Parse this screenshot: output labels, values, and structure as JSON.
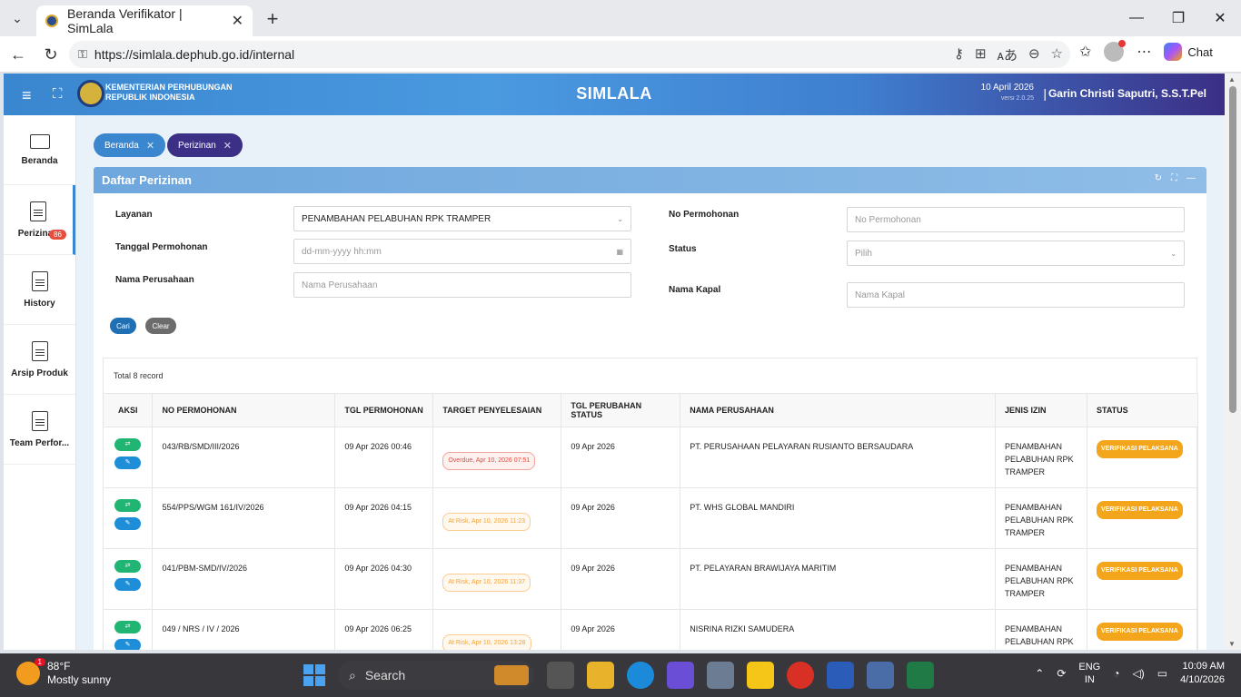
{
  "browser": {
    "tab_title": "Beranda Verifikator | SimLala",
    "url": "https://simlala.dephub.go.id/internal",
    "chat_label": "Chat"
  },
  "header": {
    "ministry_line1": "KEMENTERIAN PERHUBUNGAN",
    "ministry_line2": "REPUBLIK INDONESIA",
    "app_title": "SIMLALA",
    "date": "10 April 2026",
    "version": "versi 2.0.25",
    "separator": "|",
    "user": "Garin Christi Saputri, S.S.T.Pel"
  },
  "sidebar": {
    "items": [
      {
        "label": "Beranda"
      },
      {
        "label": "Perizinan",
        "badge": "86"
      },
      {
        "label": "History"
      },
      {
        "label": "Arsip Produk"
      },
      {
        "label": "Team Perfor..."
      }
    ]
  },
  "breadcrumb": {
    "items": [
      {
        "label": "Beranda"
      },
      {
        "label": "Perizinan"
      }
    ]
  },
  "panel": {
    "title": "Daftar Perizinan"
  },
  "filters": {
    "layanan_label": "Layanan",
    "layanan_value": "PENAMBAHAN PELABUHAN RPK TRAMPER",
    "tanggal_label": "Tanggal Permohonan",
    "tanggal_placeholder": "dd-mm-yyyy hh:mm",
    "perusahaan_label": "Nama Perusahaan",
    "perusahaan_placeholder": "Nama Perusahaan",
    "no_label": "No Permohonan",
    "no_placeholder": "No Permohonan",
    "status_label": "Status",
    "status_placeholder": "Pilih",
    "kapal_label": "Nama Kapal",
    "kapal_placeholder": "Nama Kapal",
    "search_btn": "Cari",
    "clear_btn": "Clear"
  },
  "table": {
    "total": "Total 8 record",
    "headers": [
      "AKSI",
      "NO PERMOHONAN",
      "TGL PERMOHONAN",
      "TARGET PENYELESAIAN",
      "TGL PERUBAHAN STATUS",
      "NAMA PERUSAHAAN",
      "JENIS IZIN",
      "STATUS"
    ],
    "rows": [
      {
        "no": "043/RB/SMD/III/2026",
        "tgl": "09 Apr 2026 00:46",
        "target": "Overdue, Apr 10, 2026 07:51",
        "tgl_status": "09 Apr 2026",
        "perusahaan": "PT. PERUSAHAAN PELAYARAN RUSIANTO BERSAUDARA",
        "jenis": "PENAMBAHAN PELABUHAN RPK TRAMPER",
        "status": "VERIFIKASI PELAKSANA"
      },
      {
        "no": "554/PPS/WGM 161/IV/2026",
        "tgl": "09 Apr 2026 04:15",
        "target": "At Risk, Apr 10, 2026 11:23",
        "tgl_status": "09 Apr 2026",
        "perusahaan": "PT. WHS GLOBAL MANDIRI",
        "jenis": "PENAMBAHAN PELABUHAN RPK TRAMPER",
        "status": "VERIFIKASI PELAKSANA"
      },
      {
        "no": "041/PBM-SMD/IV/2026",
        "tgl": "09 Apr 2026 04:30",
        "target": "At Risk, Apr 10, 2026 11:37",
        "tgl_status": "09 Apr 2026",
        "perusahaan": "PT. PELAYARAN BRAWIJAYA MARITIM",
        "jenis": "PENAMBAHAN PELABUHAN RPK TRAMPER",
        "status": "VERIFIKASI PELAKSANA"
      },
      {
        "no": "049 / NRS / IV / 2026",
        "tgl": "09 Apr 2026 06:25",
        "target": "At Risk, Apr 10, 2026 13:28",
        "tgl_status": "09 Apr 2026",
        "perusahaan": "NISRINA RIZKI SAMUDERA",
        "jenis": "PENAMBAHAN PELABUHAN RPK",
        "status": "VERIFIKASI PELAKSANA"
      }
    ]
  },
  "taskbar": {
    "weather_temp": "88°F",
    "weather_desc": "Mostly sunny",
    "weather_badge": "1",
    "search_placeholder": "Search",
    "lang1": "ENG",
    "lang2": "IN",
    "time": "10:09 AM",
    "date": "4/10/2026"
  },
  "colors": {
    "header_start": "#3a86cf",
    "header_end": "#3b2f86",
    "status_badge": "#f3a51c",
    "overdue": "#e74c3c",
    "at_risk": "#f2a33a"
  }
}
